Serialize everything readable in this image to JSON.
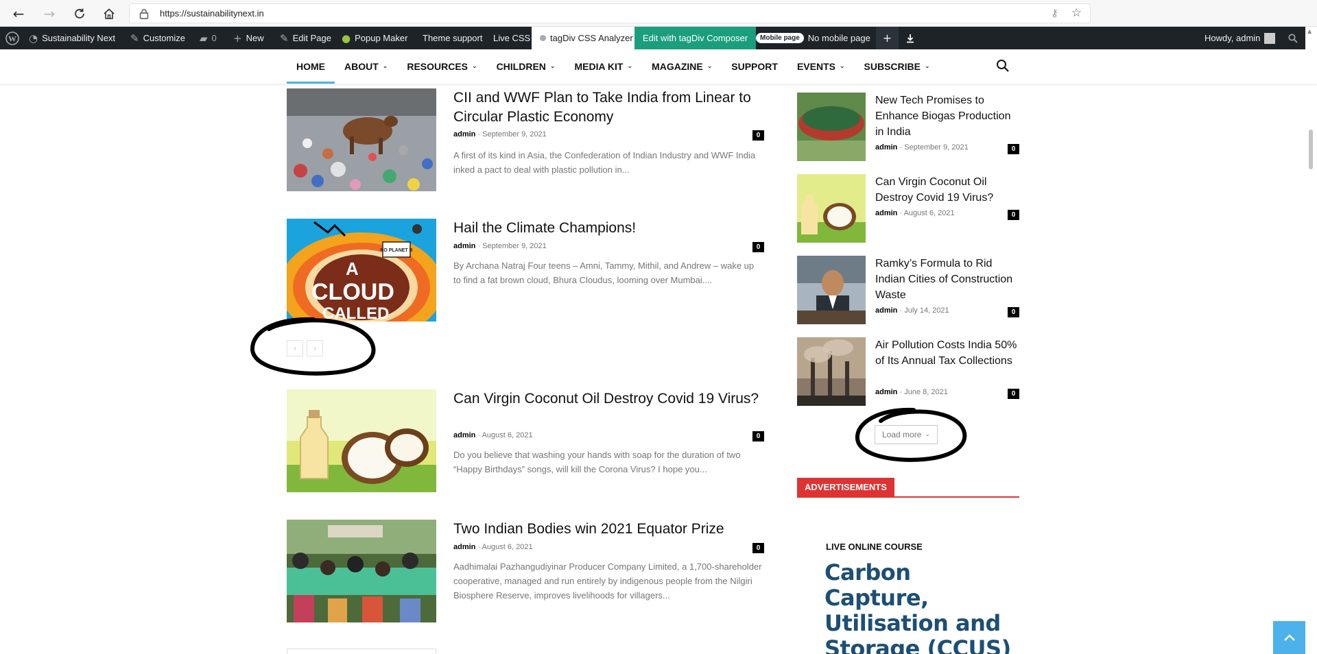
{
  "browser": {
    "url": "https://sustainabilitynext.in"
  },
  "admin_bar": {
    "site_name": "Sustainability Next",
    "customize": "Customize",
    "comments_count": "0",
    "new": "New",
    "edit_page": "Edit Page",
    "popup_maker": "Popup Maker",
    "theme_support": "Theme support",
    "live_css": "Live CSS",
    "css_analyzer": "tagDiv CSS Analyzer",
    "composer": "Edit with tagDiv Composer",
    "mobile_pill": "Mobile page",
    "no_mobile": "No mobile page",
    "howdy": "Howdy, admin"
  },
  "nav": {
    "items": [
      {
        "label": "HOME",
        "dropdown": false
      },
      {
        "label": "ABOUT",
        "dropdown": true
      },
      {
        "label": "RESOURCES",
        "dropdown": true
      },
      {
        "label": "CHILDREN",
        "dropdown": true
      },
      {
        "label": "MEDIA KIT",
        "dropdown": true
      },
      {
        "label": "MAGAZINE",
        "dropdown": true
      },
      {
        "label": "SUPPORT",
        "dropdown": false
      },
      {
        "label": "EVENTS",
        "dropdown": true
      },
      {
        "label": "SUBSCRIBE",
        "dropdown": true
      }
    ]
  },
  "posts": [
    {
      "title": "CII and WWF Plan to Take India from Linear to Circular Plastic Economy",
      "author": "admin",
      "date": "September 9, 2021",
      "comments": "0",
      "excerpt": "A first of its kind in Asia, the Confederation of Indian Industry and WWF India inked a pact to deal with plastic pollution in..."
    },
    {
      "title": "Hail the Climate Champions!",
      "author": "admin",
      "date": "September 9, 2021",
      "comments": "0",
      "excerpt": "By Archana Natraj Four teens – Amni, Tammy, Mithil, and Andrew – wake up to find a fat brown cloud, Bhura Cloudus, looming over Mumbai...."
    },
    {
      "title": "Can Virgin Coconut Oil Destroy Covid 19 Virus?",
      "author": "admin",
      "date": "August 6, 2021",
      "comments": "0",
      "excerpt": "Do you believe that washing your hands with soap for the duration of two “Happy Birthdays” songs, will kill the Corona Virus? I hope you..."
    },
    {
      "title": "Two Indian Bodies win 2021 Equator Prize",
      "author": "admin",
      "date": "August 6, 2021",
      "comments": "0",
      "excerpt": "Aadhimalai Pazhangudiyinar Producer Company Limited, a 1,700-shareholder cooperative, managed and run entirely by indigenous people from the Nilgiri Biosphere Reserve, improves livelihoods for villagers..."
    }
  ],
  "cloud_image_text": {
    "line1": "A",
    "line2": "CLOUD",
    "line3": "CALLED",
    "badge": "NO PLANET B"
  },
  "sidebar_posts": [
    {
      "title": "New Tech Promises to Enhance Biogas Production in India",
      "author": "admin",
      "date": "September 9, 2021",
      "comments": "0"
    },
    {
      "title": "Can Virgin Coconut Oil Destroy Covid 19 Virus?",
      "author": "admin",
      "date": "August 6, 2021",
      "comments": "0"
    },
    {
      "title": "Ramky’s Formula to Rid Indian Cities of Construction Waste",
      "author": "admin",
      "date": "July 14, 2021",
      "comments": "0"
    },
    {
      "title": "Air Pollution Costs India 50% of Its Annual Tax Collections",
      "author": "admin",
      "date": "June 8, 2021",
      "comments": "0"
    }
  ],
  "load_more": "Load more",
  "ads_heading": "ADVERTISEMENTS",
  "ad": {
    "kicker": "LIVE ONLINE COURSE",
    "title": "Carbon Capture, Utilisation and Storage (CCUS)"
  },
  "icons": {
    "back": "back-arrow-icon",
    "forward": "forward-arrow-icon",
    "refresh": "refresh-icon",
    "home": "home-icon",
    "search": "search-icon",
    "back_to_top": "chevron-up-icon"
  },
  "colors": {
    "accent": "#4db2ec",
    "admin_bar": "#1d2327",
    "composer_green": "#1b9e7c",
    "ads_red": "#dd3333",
    "ad_title": "#1c4f73"
  }
}
